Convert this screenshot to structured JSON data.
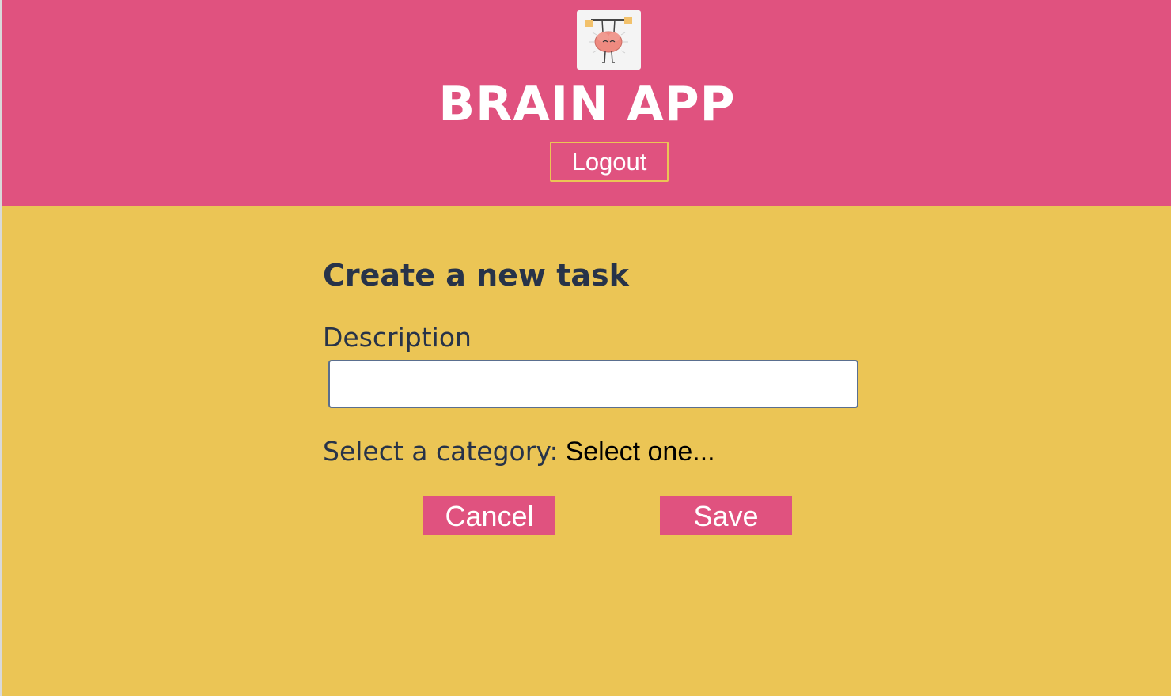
{
  "header": {
    "app_title": "BRAIN APP",
    "logout_label": "Logout",
    "logo_icon": "brain-lifting-weights-icon"
  },
  "form": {
    "title": "Create a new task",
    "description_label": "Description",
    "description_value": "",
    "category_label": "Select a category:",
    "category_selected": "Select one...",
    "cancel_label": "Cancel",
    "save_label": "Save"
  },
  "colors": {
    "header_bg": "#E0527F",
    "page_bg": "#EBC555",
    "text_dark": "#273349",
    "button_bg": "#E0527F"
  }
}
